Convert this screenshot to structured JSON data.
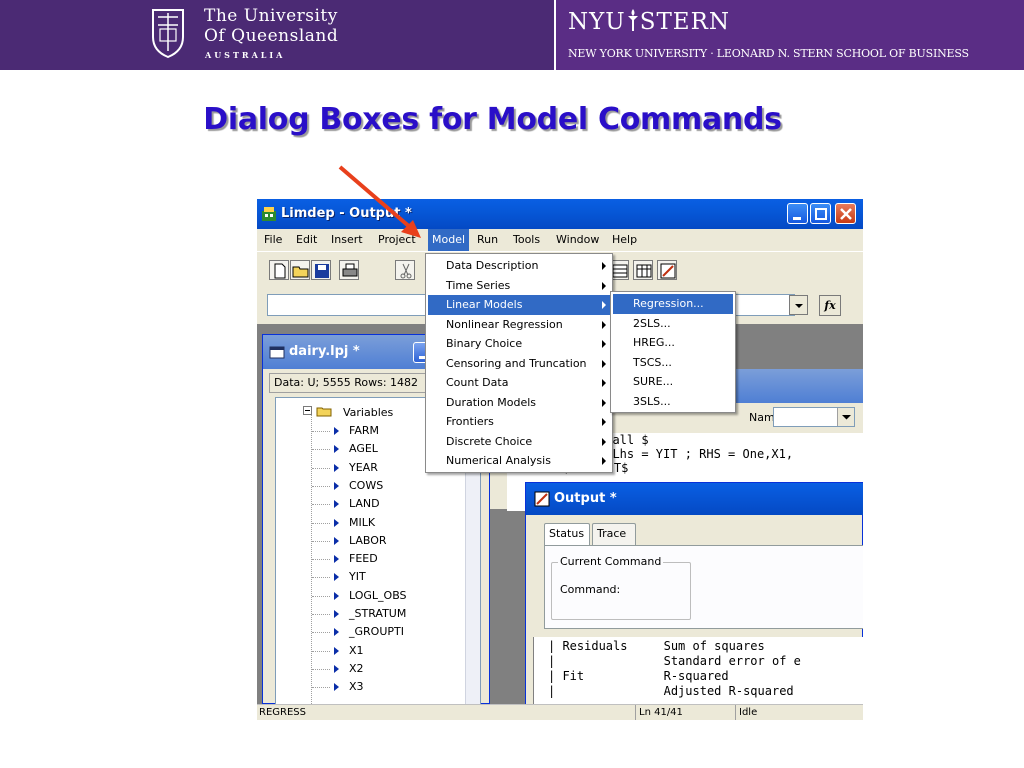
{
  "banner": {
    "uq_line1": "The University",
    "uq_line2": "Of Queensland",
    "uq_line3": "AUSTRALIA",
    "nyu_left": "NYU",
    "nyu_right": "STERN",
    "nyu_subtitle": "NEW YORK UNIVERSITY · LEONARD N. STERN SCHOOL OF BUSINESS",
    "uq_color": "#4b2a74",
    "nyu_color": "#5a2d85"
  },
  "slide": {
    "title": "Dialog Boxes for Model Commands",
    "title_color": "#2a0fc8",
    "arrow_color": "#e8401c"
  },
  "window": {
    "title": "Limdep - Output *",
    "menu": [
      "File",
      "Edit",
      "Insert",
      "Project",
      "Model",
      "Run",
      "Tools",
      "Window",
      "Help"
    ],
    "active_menu": "Model"
  },
  "toolbar_icons": [
    "new-document-icon",
    "open-folder-icon",
    "save-icon",
    "print-icon",
    "cut-icon",
    "copy-icon",
    "grid-icon",
    "table-icon",
    "chart-icon"
  ],
  "formula_bar": {
    "value": "",
    "fx_label": "fx"
  },
  "project": {
    "title": "dairy.lpj *",
    "info": "Data: U; 5555 Rows: 1482",
    "root": "Variables",
    "variables": [
      "FARM",
      "AGEL",
      "YEAR",
      "COWS",
      "LAND",
      "MILK",
      "LABOR",
      "FEED",
      "YIT",
      "LOGL_OBS",
      "_STRATUM",
      "_GROUPTI",
      "X1",
      "X2",
      "X3"
    ]
  },
  "command_window": {
    "name_label": "Name:",
    "name_value": "",
    "lines": [
      "; all $",
      "; Lhs = YIT ; RHS = One,X1,",
      "Rhs=X1;Rhs=YIT$"
    ]
  },
  "output_window": {
    "title": "Output *",
    "tabs": [
      "Status",
      "Trace"
    ],
    "group_label": "Current Command",
    "command_label": "Command:",
    "lines": [
      "| Residuals     Sum of squares",
      "|               Standard error of e",
      "| Fit           R-squared",
      "|               Adjusted R-squared"
    ]
  },
  "model_menu": {
    "items": [
      "Data Description",
      "Time Series",
      "Linear Models",
      "Nonlinear Regression",
      "Binary Choice",
      "Censoring and Truncation",
      "Count Data",
      "Duration Models",
      "Frontiers",
      "Discrete Choice",
      "Numerical Analysis"
    ],
    "selected": "Linear Models"
  },
  "linear_menu": {
    "items": [
      "Regression...",
      "2SLS...",
      "HREG...",
      "TSCS...",
      "SURE...",
      "3SLS..."
    ],
    "selected": "Regression..."
  },
  "status_bar": {
    "left": "REGRESS",
    "position": "Ln 41/41",
    "state": "Idle"
  }
}
